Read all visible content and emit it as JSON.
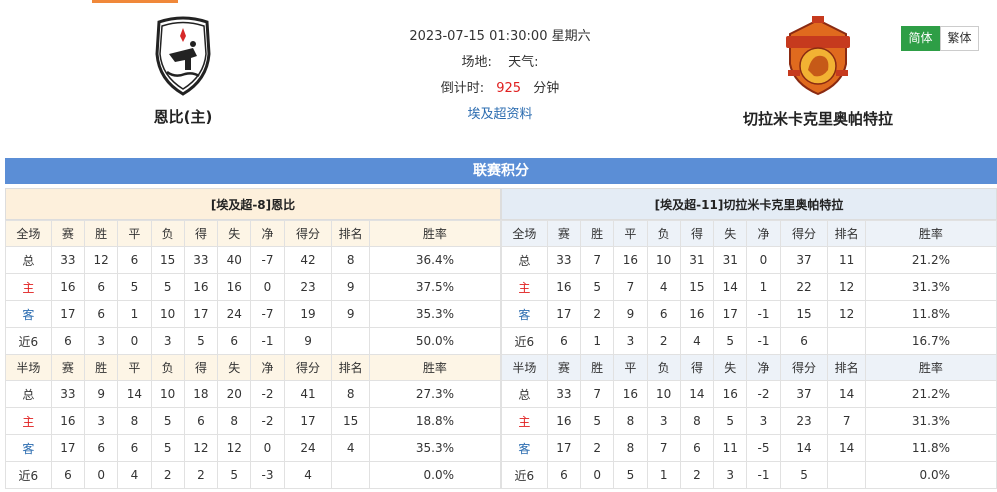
{
  "home": {
    "name": "恩比(主)"
  },
  "away": {
    "name": "切拉米卡克里奥帕特拉"
  },
  "match": {
    "datetime": "2023-07-15 01:30:00 星期六",
    "venue_label": "场地:",
    "weather_label": "天气:",
    "countdown_label": "倒计时:",
    "countdown_value": "925",
    "countdown_unit": "分钟",
    "league_link": "埃及超资料"
  },
  "lang": {
    "simplified": "简体",
    "traditional": "繁体"
  },
  "standings": {
    "title": "联赛积分",
    "columns_full": [
      "全场",
      "赛",
      "胜",
      "平",
      "负",
      "得",
      "失",
      "净",
      "得分",
      "排名",
      "胜率"
    ],
    "columns_half": [
      "半场",
      "赛",
      "胜",
      "平",
      "负",
      "得",
      "失",
      "净",
      "得分",
      "排名",
      "胜率"
    ],
    "home": {
      "title": "[埃及超-8]恩比",
      "full": [
        [
          "总",
          "33",
          "12",
          "6",
          "15",
          "33",
          "40",
          "-7",
          "42",
          "8",
          "36.4%"
        ],
        [
          "主",
          "16",
          "6",
          "5",
          "5",
          "16",
          "16",
          "0",
          "23",
          "9",
          "37.5%"
        ],
        [
          "客",
          "17",
          "6",
          "1",
          "10",
          "17",
          "24",
          "-7",
          "19",
          "9",
          "35.3%"
        ],
        [
          "近6",
          "6",
          "3",
          "0",
          "3",
          "5",
          "6",
          "-1",
          "9",
          "",
          "50.0%"
        ]
      ],
      "half": [
        [
          "总",
          "33",
          "9",
          "14",
          "10",
          "18",
          "20",
          "-2",
          "41",
          "8",
          "27.3%"
        ],
        [
          "主",
          "16",
          "3",
          "8",
          "5",
          "6",
          "8",
          "-2",
          "17",
          "15",
          "18.8%"
        ],
        [
          "客",
          "17",
          "6",
          "6",
          "5",
          "12",
          "12",
          "0",
          "24",
          "4",
          "35.3%"
        ],
        [
          "近6",
          "6",
          "0",
          "4",
          "2",
          "2",
          "5",
          "-3",
          "4",
          "",
          "0.0%"
        ]
      ]
    },
    "away": {
      "title": "[埃及超-11]切拉米卡克里奥帕特拉",
      "full": [
        [
          "总",
          "33",
          "7",
          "16",
          "10",
          "31",
          "31",
          "0",
          "37",
          "11",
          "21.2%"
        ],
        [
          "主",
          "16",
          "5",
          "7",
          "4",
          "15",
          "14",
          "1",
          "22",
          "12",
          "31.3%"
        ],
        [
          "客",
          "17",
          "2",
          "9",
          "6",
          "16",
          "17",
          "-1",
          "15",
          "12",
          "11.8%"
        ],
        [
          "近6",
          "6",
          "1",
          "3",
          "2",
          "4",
          "5",
          "-1",
          "6",
          "",
          "16.7%"
        ]
      ],
      "half": [
        [
          "总",
          "33",
          "7",
          "16",
          "10",
          "14",
          "16",
          "-2",
          "37",
          "14",
          "21.2%"
        ],
        [
          "主",
          "16",
          "5",
          "8",
          "3",
          "8",
          "5",
          "3",
          "23",
          "7",
          "31.3%"
        ],
        [
          "客",
          "17",
          "2",
          "8",
          "7",
          "6",
          "11",
          "-5",
          "14",
          "14",
          "11.8%"
        ],
        [
          "近6",
          "6",
          "0",
          "5",
          "1",
          "2",
          "3",
          "-1",
          "5",
          "",
          "0.0%"
        ]
      ]
    }
  }
}
